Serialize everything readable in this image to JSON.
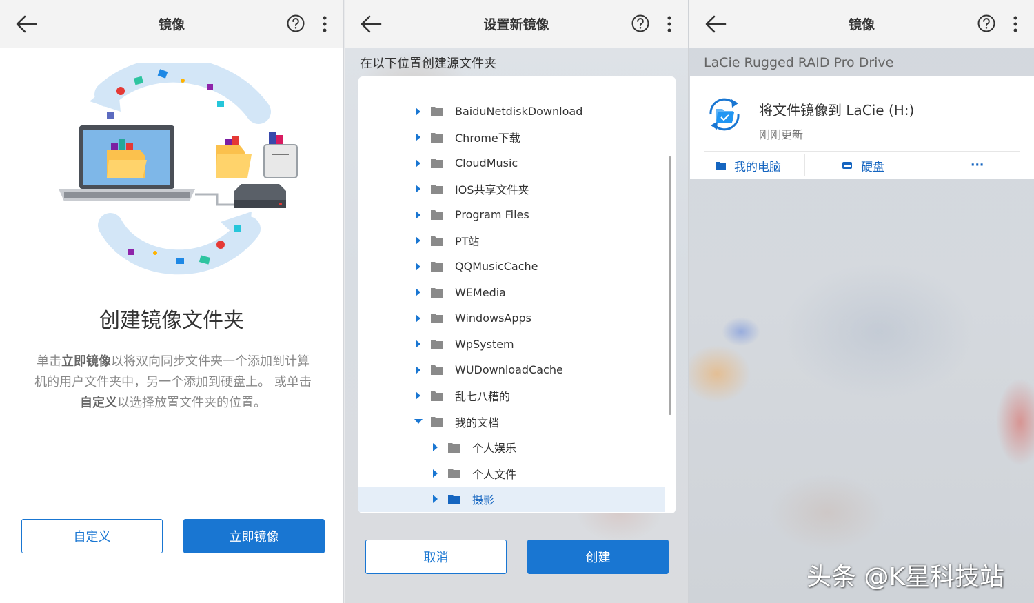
{
  "panel_create": {
    "title": "镜像",
    "heading": "创建镜像文件夹",
    "description": {
      "p1": "单击",
      "b1": "立即镜像",
      "p2": "以将双向同步文件夹一个添加到计算机的用户文件夹中，另一个添加到硬盘上。 或单击",
      "b2": "自定义",
      "p3": "以选择放置文件夹的位置。"
    },
    "buttons": {
      "custom": "自定义",
      "mirror_now": "立即镜像"
    }
  },
  "panel_new": {
    "title": "设置新镜像",
    "location_label": "在以下位置创建源文件夹",
    "tree": [
      {
        "label": "BaiduNetdiskDownload",
        "level": 0,
        "expanded": false,
        "selected": false
      },
      {
        "label": "Chrome下载",
        "level": 0,
        "expanded": false,
        "selected": false
      },
      {
        "label": "CloudMusic",
        "level": 0,
        "expanded": false,
        "selected": false
      },
      {
        "label": "IOS共享文件夹",
        "level": 0,
        "expanded": false,
        "selected": false
      },
      {
        "label": "Program Files",
        "level": 0,
        "expanded": false,
        "selected": false
      },
      {
        "label": "PT站",
        "level": 0,
        "expanded": false,
        "selected": false
      },
      {
        "label": "QQMusicCache",
        "level": 0,
        "expanded": false,
        "selected": false
      },
      {
        "label": "WEMedia",
        "level": 0,
        "expanded": false,
        "selected": false
      },
      {
        "label": "WindowsApps",
        "level": 0,
        "expanded": false,
        "selected": false
      },
      {
        "label": "WpSystem",
        "level": 0,
        "expanded": false,
        "selected": false
      },
      {
        "label": "WUDownloadCache",
        "level": 0,
        "expanded": false,
        "selected": false
      },
      {
        "label": "乱七八糟的",
        "level": 0,
        "expanded": false,
        "selected": false
      },
      {
        "label": "我的文档",
        "level": 0,
        "expanded": true,
        "selected": false
      },
      {
        "label": "个人娱乐",
        "level": 1,
        "expanded": false,
        "selected": false
      },
      {
        "label": "个人文件",
        "level": 1,
        "expanded": false,
        "selected": false
      },
      {
        "label": "摄影",
        "level": 1,
        "expanded": false,
        "selected": true
      }
    ],
    "buttons": {
      "cancel": "取消",
      "create": "创建"
    }
  },
  "panel_mirror": {
    "title": "镜像",
    "drive_name": "LaCie Rugged RAID Pro Drive",
    "card": {
      "title": "将文件镜像到 LaCie (H:)",
      "status": "刚刚更新",
      "actions": [
        "我的电脑",
        "硬盘",
        "···"
      ]
    }
  },
  "watermark": "头条 @K星科技站",
  "colors": {
    "accent": "#1976d2",
    "selected_row": "#e5eef8",
    "topbar": "#f3f3f3"
  },
  "icons": [
    "back-arrow-icon",
    "help-icon",
    "more-vertical-icon",
    "folder-icon",
    "caret-right-icon",
    "caret-down-icon",
    "sync-folder-icon",
    "computer-icon",
    "drive-icon"
  ]
}
